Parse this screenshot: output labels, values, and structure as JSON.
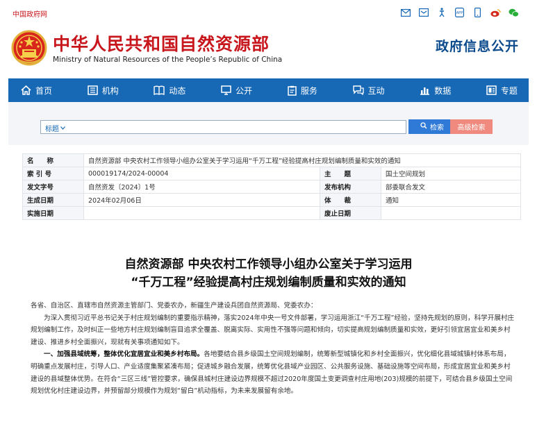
{
  "top": {
    "gov_link": "中国政府网",
    "icons": [
      "mail-icon",
      "email-icon",
      "accessibility-icon",
      "app-icon",
      "mobile-icon",
      "weibo-icon",
      "wechat-icon"
    ]
  },
  "header": {
    "ministry_cn": "中华人民共和国自然资源部",
    "ministry_en": "Ministry of Natural Resources of the People’s Republic of China",
    "gov_info": "政府信息公开"
  },
  "nav": {
    "items": [
      {
        "label": "首页",
        "icon": "home-icon"
      },
      {
        "label": "机构",
        "icon": "org-icon"
      },
      {
        "label": "动态",
        "icon": "news-icon"
      },
      {
        "label": "公开",
        "icon": "monitor-icon"
      },
      {
        "label": "服务",
        "icon": "service-icon"
      },
      {
        "label": "互动",
        "icon": "chat-icon"
      },
      {
        "label": "数据",
        "icon": "chart-icon"
      },
      {
        "label": "专题",
        "icon": "topic-icon"
      }
    ]
  },
  "search": {
    "scope": "标题",
    "value": "",
    "search_label": "检索",
    "advanced_label": "高级检索"
  },
  "meta": {
    "name_label": "名　　称",
    "name_value": "自然资源部 中央农村工作领导小组办公室关于学习运用“千万工程”经验提高村庄规划编制质量和实效的通知",
    "index_label": "索 引 号",
    "index_value": "000019174/2024-00004",
    "subject_label": "主　　题",
    "subject_value": "国土空间规划",
    "doc_no_label": "发文字号",
    "doc_no_value": "自然资发〔2024〕1号",
    "issuer_label": "发布机构",
    "issuer_value": "部委联合发文",
    "date_label": "生成日期",
    "date_value": "2024年02月06日",
    "genre_label": "体　　裁",
    "genre_value": "通知",
    "effective_label": "实施日期",
    "effective_value": "",
    "repeal_label": "废止日期",
    "repeal_value": ""
  },
  "article": {
    "title_line1": "自然资源部 中央农村工作领导小组办公室关于学习运用",
    "title_line2": "“千万工程”经验提高村庄规划编制质量和实效的通知",
    "salutation": "各省、自治区、直辖市自然资源主管部门、党委农办，新疆生产建设兵团自然资源局、党委农办：",
    "para1": "为深入贯彻习近平总书记关于村庄规划编制的重要指示精神，落实2024年中央一号文件部署，学习运用浙江“千万工程”经验，坚持先规划的原则，科学开展村庄规划编制工作，及时纠正一些地方村庄规划编制盲目追求全覆盖、脱离实际、实用性不强等问题和倾向，切实提高规划编制质量和实效，更好引领宜居宜业和美乡村建设、推进乡村全面振兴，现就有关事项通知如下。",
    "para2_heading": "一、加强县域统筹，整体优化宜居宜业和美乡村布局。",
    "para2": "各地要结合县乡级国土空间规划编制，统筹新型城镇化和乡村全面振兴，优化细化县域城镇村体系布局，明确重点发展村庄，引导人口、产业适度集聚紧凑布局；促进城乡融合发展，统筹优化县域产业园区、公共服务设施、基础设施等空间布局，形成宜居宜业和美乡村建设的县域整体优势。在符合“三区三线”管控要求，确保县城村庄建设边界规模不超过2020年度国土变更调查村庄用地(203)规模的前提下，可结合县乡级国土空间规划优化村庄建设边界，并预留部分规模作为规划“留白”机动指标，为未来发展留有余地。"
  }
}
